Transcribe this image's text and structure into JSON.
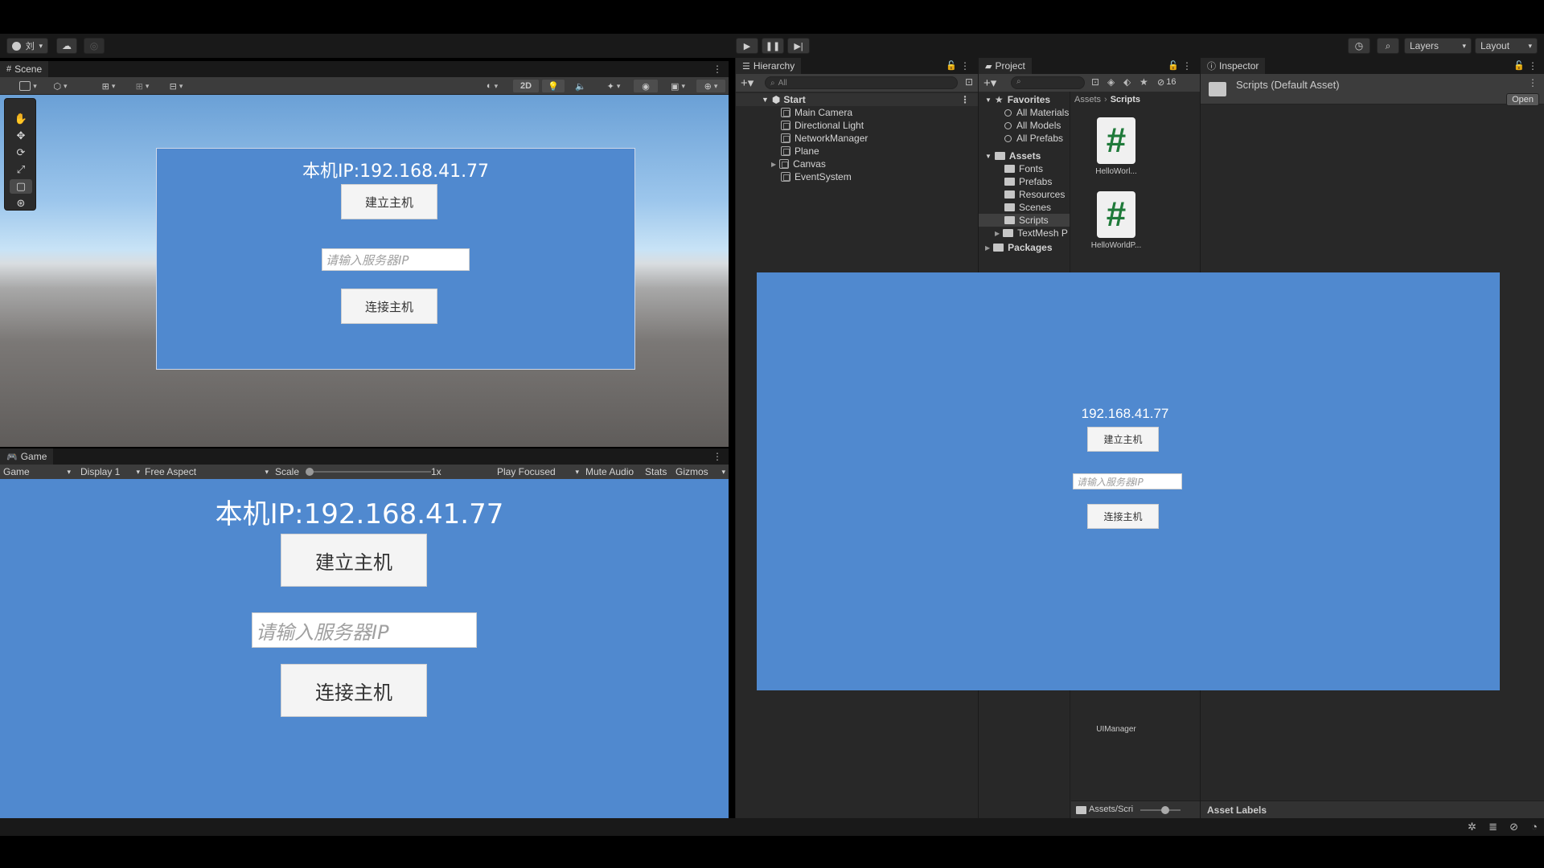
{
  "toolbar": {
    "account_label": "刘",
    "layers_label": "Layers",
    "layout_label": "Layout"
  },
  "scene": {
    "tab_label": "Scene",
    "mode_2d_label": "2D",
    "ui": {
      "ip_text": "本机IP:192.168.41.77",
      "host_button": "建立主机",
      "input_placeholder": "请输入服务器IP",
      "connect_button": "连接主机"
    }
  },
  "game": {
    "tab_label": "Game",
    "toolbar": {
      "mode": "Game",
      "display": "Display 1",
      "aspect": "Free Aspect",
      "scale_label": "Scale",
      "scale_value": "1x",
      "play_focused": "Play Focused",
      "mute_audio": "Mute Audio",
      "stats": "Stats",
      "gizmos": "Gizmos"
    },
    "ui": {
      "ip_text": "本机IP:192.168.41.77",
      "host_button": "建立主机",
      "input_placeholder": "请输入服务器IP",
      "connect_button": "连接主机"
    }
  },
  "hierarchy": {
    "tab_label": "Hierarchy",
    "search_placeholder": "All",
    "scene_name": "Start",
    "items": [
      "Main Camera",
      "Directional Light",
      "NetworkManager",
      "Plane",
      "Canvas",
      "EventSystem"
    ]
  },
  "project": {
    "tab_label": "Project",
    "hidden_count": "16",
    "favorites_label": "Favorites",
    "favorites": [
      "All Materials",
      "All Models",
      "All Prefabs"
    ],
    "assets_label": "Assets",
    "folders": [
      "Fonts",
      "Prefabs",
      "Resources",
      "Scenes",
      "Scripts",
      "TextMesh P"
    ],
    "packages_label": "Packages",
    "breadcrumb": [
      "Assets",
      "Scripts"
    ],
    "assets": [
      "HelloWorl...",
      "HelloWorldP...",
      "UIManager"
    ],
    "path_label": "Assets/Scri"
  },
  "inspector": {
    "tab_label": "Inspector",
    "title": "Scripts (Default Asset)",
    "open_button": "Open",
    "asset_labels": "Asset Labels"
  },
  "overlay": {
    "ip_text": "192.168.41.77",
    "host_button": "建立主机",
    "input_placeholder": "请输入服务器IP",
    "connect_button": "连接主机"
  }
}
